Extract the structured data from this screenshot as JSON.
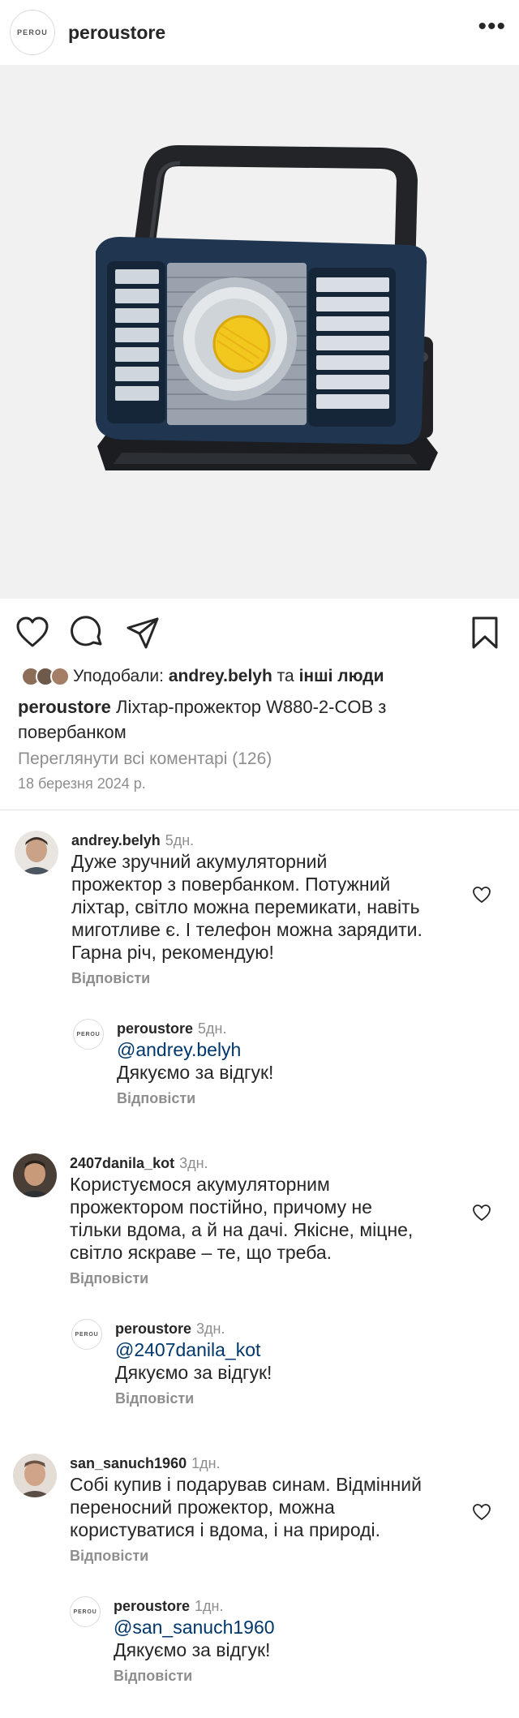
{
  "header": {
    "logo_text": "PEROU",
    "username": "peroustore",
    "more_icon": "more-horizontal-icon"
  },
  "actions": {
    "like_icon": "heart-icon",
    "comment_icon": "comment-icon",
    "share_icon": "send-icon",
    "save_icon": "bookmark-icon"
  },
  "likes": {
    "prefix": "Уподобали:",
    "user": "andrey.belyh",
    "joiner": "та",
    "others": "інші люди"
  },
  "caption": {
    "username": "peroustore",
    "text": "Ліхтар-прожектор W880-2-COB з повербанком"
  },
  "view_all_comments": "Переглянути всі коментарі (126)",
  "date": "18 березня 2024 р.",
  "comments": [
    {
      "username": "andrey.belyh",
      "time": "5дн.",
      "text": "Дуже зручний акумуляторний\nпрожектор з повербанком. Потужний\nліхтар, світло можна перемикати, навіть\nмиготливе є. І телефон можна зарядити.\nГарна річ, рекомендую!",
      "reply_label": "Відповісти",
      "avatar_color": "#7a6a5c"
    },
    {
      "username": "peroustore",
      "time": "5дн.",
      "mention": "@andrey.belyh",
      "text": "Дякуємо за відгук!",
      "reply_label": "Відповісти",
      "logo_text": "PEROU"
    },
    {
      "username": "2407danila_kot",
      "time": "3дн.",
      "text": "Користуємося акумуляторним\nпрожектором постійно, причому не\nтільки вдома, а й на дачі. Якісне, міцне,\nсвітло яскраве – те, що треба.",
      "reply_label": "Відповісти",
      "avatar_color": "#8a7258"
    },
    {
      "username": "peroustore",
      "time": "3дн.",
      "mention": "@2407danila_kot",
      "text": "Дякуємо за відгук!",
      "reply_label": "Відповісти",
      "logo_text": "PEROU"
    },
    {
      "username": "san_sanuch1960",
      "time": "1дн.",
      "text": "Собі купив і подарував синам. Відмінний\nпереносний прожектор, можна\nкористуватися і вдома, і на природі.",
      "reply_label": "Відповісти",
      "avatar_color": "#9a7a66"
    },
    {
      "username": "peroustore",
      "time": "1дн.",
      "mention": "@san_sanuch1960",
      "text": "Дякуємо за відгук!",
      "reply_label": "Відповісти",
      "logo_text": "PEROU"
    }
  ]
}
